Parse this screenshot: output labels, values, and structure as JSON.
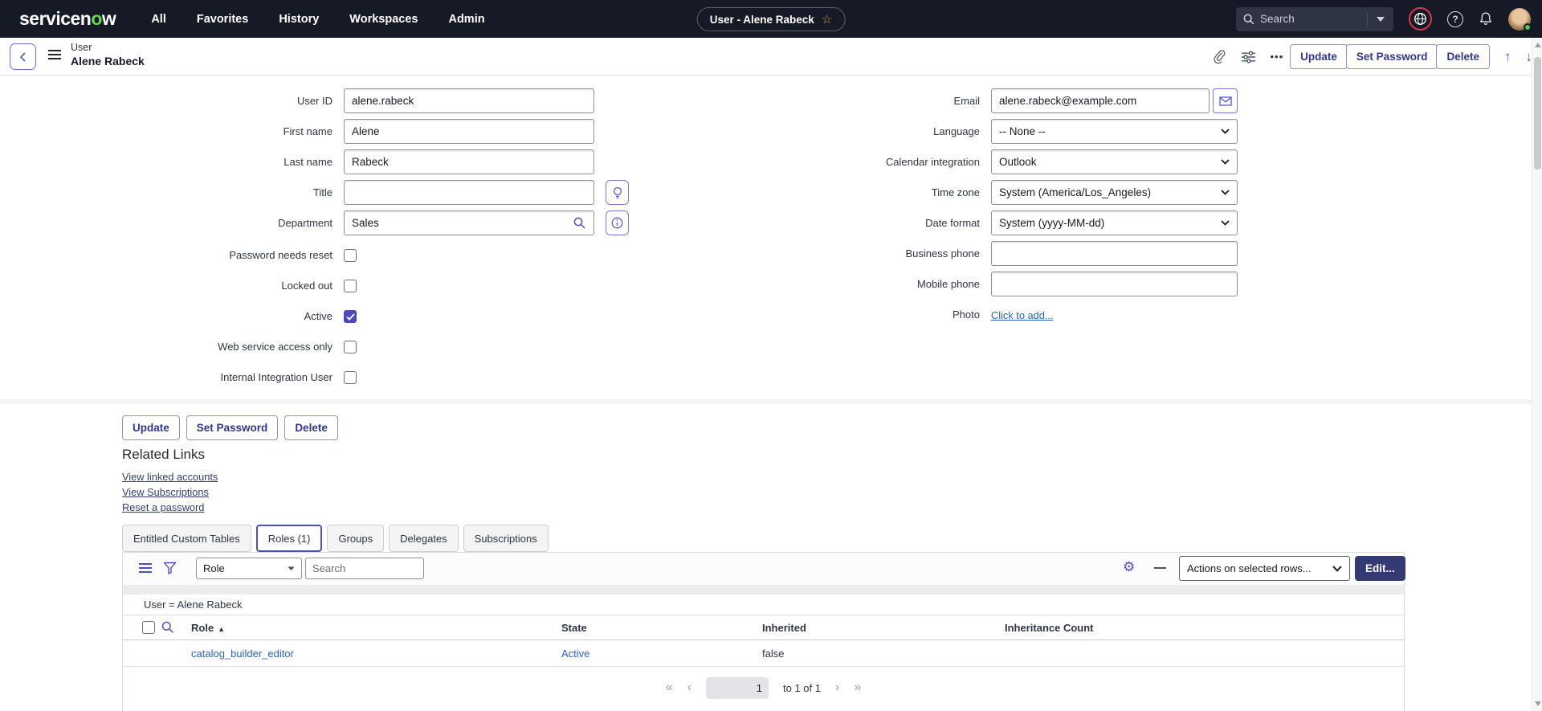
{
  "nav": {
    "logo_prefix": "servicen",
    "logo_o": "o",
    "logo_suffix": "w",
    "items": [
      {
        "label": "All"
      },
      {
        "label": "Favorites"
      },
      {
        "label": "History"
      },
      {
        "label": "Workspaces"
      },
      {
        "label": "Admin"
      }
    ],
    "context_pill": {
      "label": "User - Alene Rabeck",
      "star": "☆"
    },
    "search": {
      "placeholder": "Search"
    },
    "help_glyph": "?"
  },
  "header": {
    "record_type": "User",
    "record_name": "Alene Rabeck",
    "more": "•••",
    "nav_up": "↑",
    "nav_down": "↓"
  },
  "actions": [
    {
      "label": "Update"
    },
    {
      "label": "Set Password"
    },
    {
      "label": "Delete"
    }
  ],
  "form": {
    "left_fields": [
      {
        "label": "User ID",
        "value": "alene.rabeck"
      },
      {
        "label": "First name",
        "value": "Alene"
      },
      {
        "label": "Last name",
        "value": "Rabeck"
      },
      {
        "label": "Title",
        "value": ""
      },
      {
        "label": "Department",
        "value": "Sales"
      }
    ],
    "checkboxes": [
      {
        "label": "Password needs reset",
        "checked": false
      },
      {
        "label": "Locked out",
        "checked": false
      },
      {
        "label": "Active",
        "checked": true
      },
      {
        "label": "Web service access only",
        "checked": false
      },
      {
        "label": "Internal Integration User",
        "checked": false
      }
    ],
    "right_fields": [
      {
        "label": "Email",
        "value": "alene.rabeck@example.com",
        "type": "email"
      },
      {
        "label": "Language",
        "value": "-- None --",
        "type": "select"
      },
      {
        "label": "Calendar integration",
        "value": "Outlook",
        "type": "select"
      },
      {
        "label": "Time zone",
        "value": "System (America/Los_Angeles)",
        "type": "select"
      },
      {
        "label": "Date format",
        "value": "System (yyyy-MM-dd)",
        "type": "select"
      },
      {
        "label": "Business phone",
        "value": "",
        "type": "text"
      },
      {
        "label": "Mobile phone",
        "value": "",
        "type": "text"
      }
    ],
    "photo": {
      "label": "Photo",
      "link": "Click to add..."
    }
  },
  "related_links": {
    "title": "Related Links",
    "links": [
      {
        "label": "View linked accounts"
      },
      {
        "label": "View Subscriptions"
      },
      {
        "label": "Reset a password"
      }
    ]
  },
  "tabs": [
    {
      "label": "Entitled Custom Tables",
      "active": false
    },
    {
      "label": "Roles (1)",
      "active": true
    },
    {
      "label": "Groups",
      "active": false
    },
    {
      "label": "Delegates",
      "active": false
    },
    {
      "label": "Subscriptions",
      "active": false
    }
  ],
  "roles_list": {
    "filter_select": "Role",
    "search_placeholder": "Search",
    "actions_select": "Actions on selected rows...",
    "edit_button": "Edit...",
    "breadcrumb": "User = Alene Rabeck",
    "columns": [
      {
        "label": "Role",
        "sort": "▲"
      },
      {
        "label": "State"
      },
      {
        "label": "Inherited"
      },
      {
        "label": "Inheritance Count"
      }
    ],
    "rows": [
      {
        "role": "catalog_builder_editor",
        "state": "Active",
        "inherited": "false",
        "inheritance_count": ""
      }
    ],
    "pagination": {
      "first": "«",
      "prev": "‹",
      "page": "1",
      "range": "to 1 of 1",
      "next": "›",
      "last": "»"
    }
  }
}
